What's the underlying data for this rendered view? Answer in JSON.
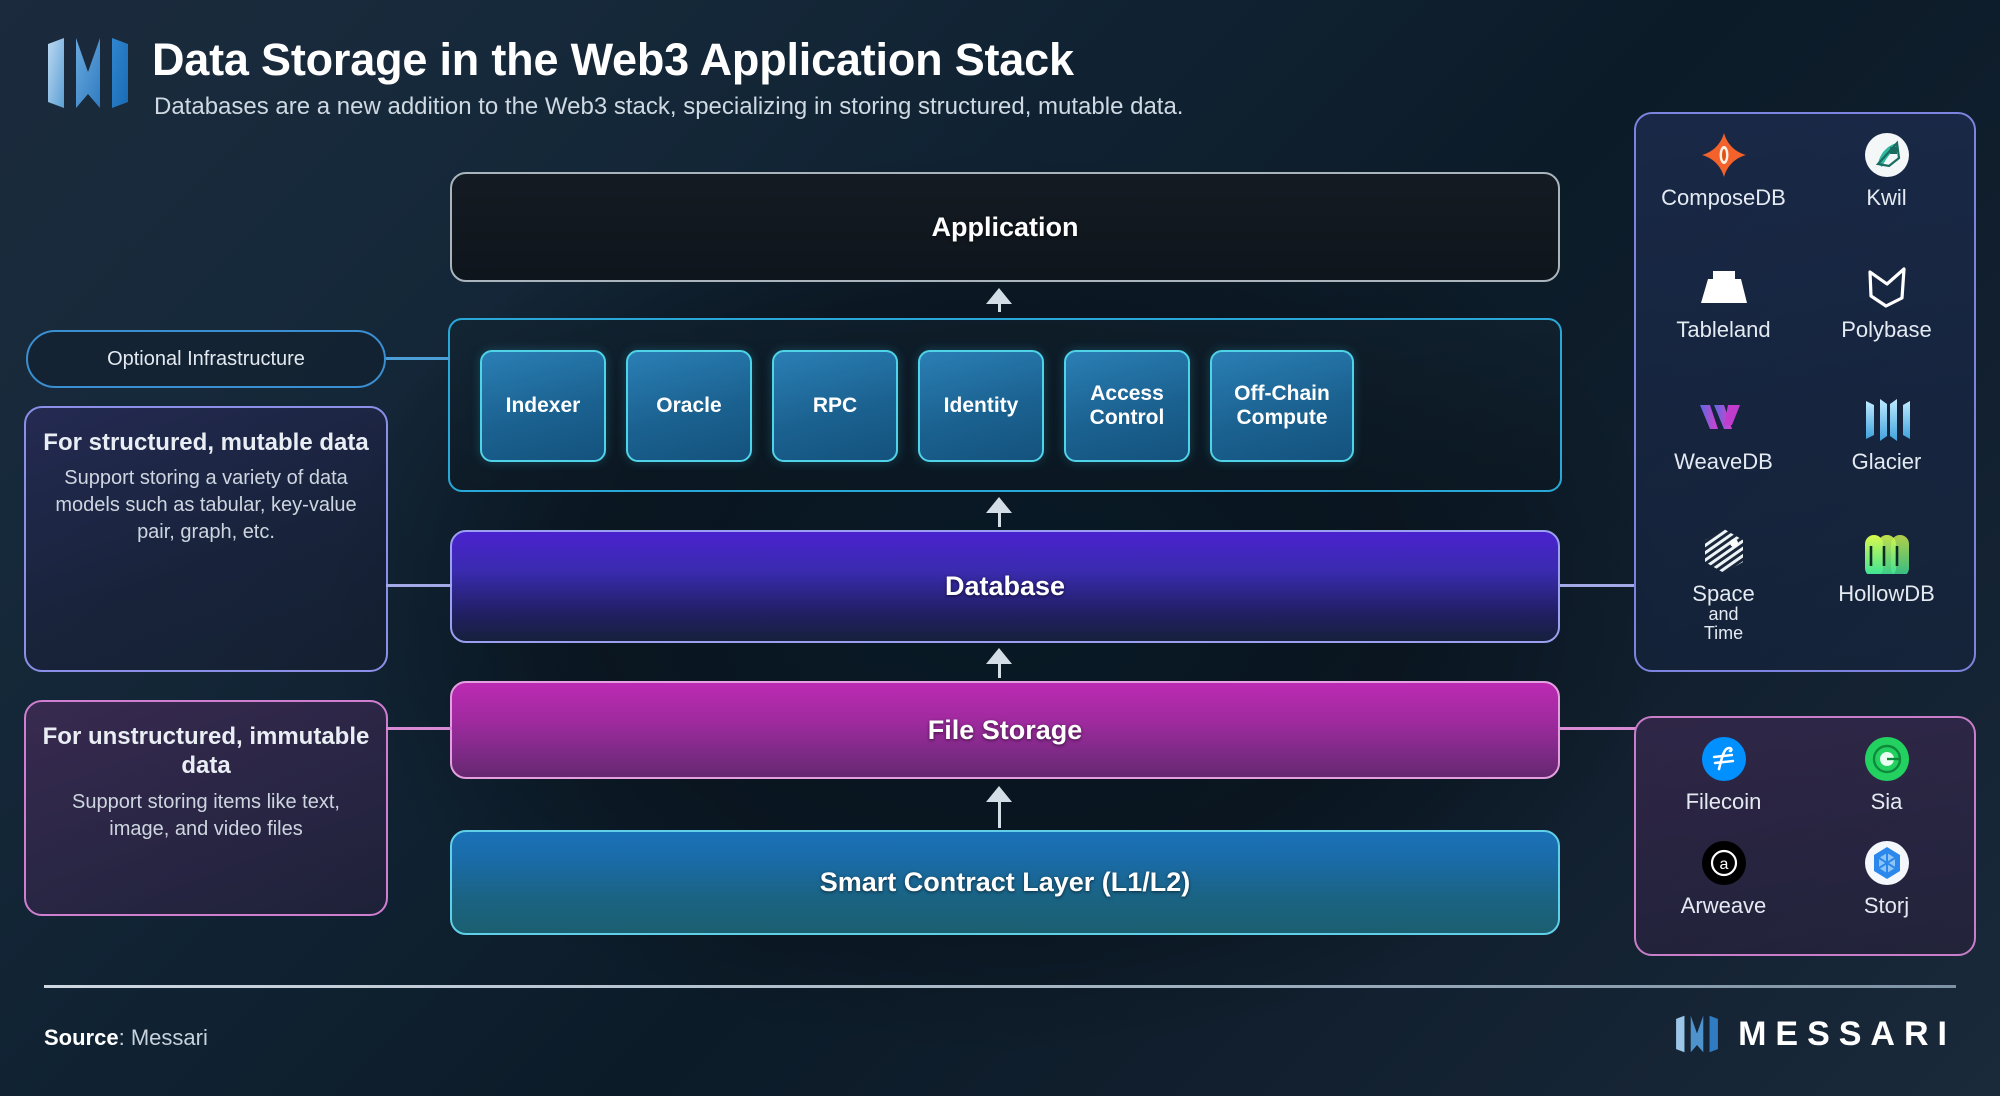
{
  "header": {
    "title": "Data Storage in the Web3 Application Stack",
    "subtitle": "Databases are a new addition to the Web3 stack, specializing in storing structured, mutable data.",
    "logo_icon": "messari-m-logo"
  },
  "stack": {
    "application": "Application",
    "database": "Database",
    "file_storage": "File Storage",
    "smart_contract": "Smart Contract Layer (L1/L2)",
    "optional_infrastructure": [
      "Indexer",
      "Oracle",
      "RPC",
      "Identity",
      "Access Control",
      "Off-Chain Compute"
    ]
  },
  "left": {
    "optional_label": "Optional Infrastructure",
    "structured": {
      "title": "For structured, mutable data",
      "body": "Support storing a variety of data models such as tabular, key-value pair, graph, etc."
    },
    "unstructured": {
      "title": "For unstructured, immutable data",
      "body": "Support storing items like text, image, and video files"
    }
  },
  "right": {
    "databases": [
      {
        "name": "ComposeDB",
        "icon": "composedb-diamond-icon",
        "color": "#f2622a"
      },
      {
        "name": "Kwil",
        "icon": "kwil-feather-icon",
        "color": "#ffffff"
      },
      {
        "name": "Tableland",
        "icon": "tableland-table-icon",
        "color": "#ffffff"
      },
      {
        "name": "Polybase",
        "icon": "polybase-crown-icon",
        "color": "#ffffff"
      },
      {
        "name": "WeaveDB",
        "icon": "weavedb-chevrons-icon",
        "color": "#9b5de5"
      },
      {
        "name": "Glacier",
        "icon": "glacier-pillars-icon",
        "color": "#55b9e8"
      },
      {
        "name": "Space",
        "name_sub_1": "and",
        "name_sub_2": "Time",
        "icon": "space-and-time-hex-icon",
        "color": "#ffffff"
      },
      {
        "name": "HollowDB",
        "icon": "hollowdb-arches-icon",
        "color": "#7ef29d"
      }
    ],
    "storage": [
      {
        "name": "Filecoin",
        "icon": "filecoin-coin-icon",
        "color": "#0090ff"
      },
      {
        "name": "Sia",
        "icon": "sia-ring-icon",
        "color": "#23d160"
      },
      {
        "name": "Arweave",
        "icon": "arweave-circle-a-icon",
        "color": "#000000"
      },
      {
        "name": "Storj",
        "icon": "storj-cube-icon",
        "color": "#2a88ec"
      }
    ]
  },
  "footer": {
    "source_label": "Source",
    "source_value": ": Messari",
    "brand": "MESSARI",
    "brand_icon": "messari-m-logo"
  },
  "colors": {
    "background": "#101f2d",
    "application_border": "#a9b4bd",
    "optional_border": "#29a8d8",
    "database_border": "#9a9ff0",
    "file_storage_border": "#e49fe0",
    "smart_contract_border": "#5fd0e8"
  }
}
